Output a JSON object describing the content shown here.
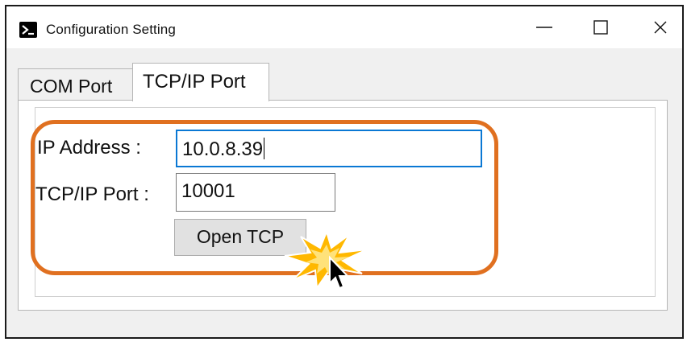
{
  "window": {
    "title": "Configuration Setting",
    "icon": "terminal-icon",
    "controls": [
      "minimize-icon",
      "maximize-icon",
      "close-icon"
    ]
  },
  "tabs": [
    {
      "label": "COM Port",
      "selected": false
    },
    {
      "label": "TCP/IP Port",
      "selected": true
    }
  ],
  "form": {
    "ip_label": "IP Address :",
    "ip_value": "10.0.8.39",
    "port_label": "TCP/IP Port :",
    "port_value": "10001",
    "open_button": "Open TCP"
  },
  "annotation": {
    "highlight_color": "#e07020",
    "burst_color": "#ffb800",
    "cursor": "mouse-pointer-icon"
  },
  "colors": {
    "focus_border": "#0a78d4",
    "button_bg": "#e1e1e1"
  }
}
